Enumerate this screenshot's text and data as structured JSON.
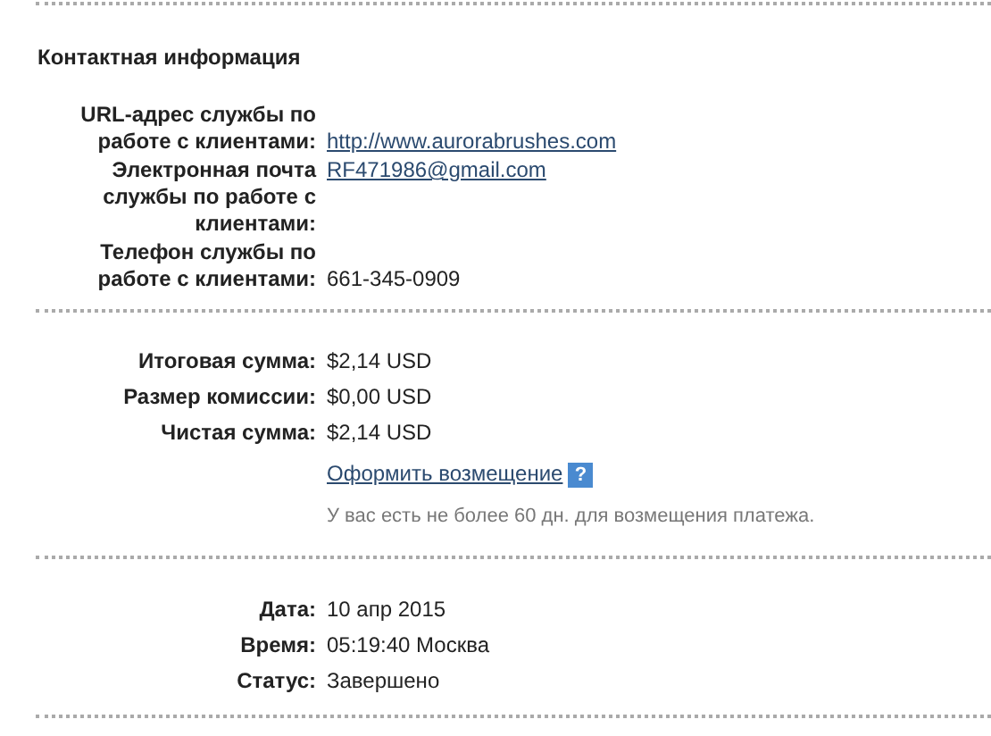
{
  "heading": "Контактная информация",
  "sections": [
    {
      "rows": [
        {
          "kind": "trailing",
          "label": "URL-адрес службы по работе с клиентами:",
          "value": {
            "kind": "link",
            "text": "http://www.aurorabrushes.com"
          }
        },
        {
          "kind": "pair",
          "label": "Электронная почта службы по работе с клиентами:",
          "value": {
            "kind": "link",
            "text": "RF471986@gmail.com"
          }
        },
        {
          "kind": "trailing",
          "label": "Телефон службы по работе с клиентами:",
          "value": {
            "kind": "plain",
            "text": "661-345-0909"
          }
        }
      ]
    },
    {
      "rows": [
        {
          "kind": "pair",
          "label": "Итоговая сумма:",
          "value": {
            "kind": "plain",
            "text": "$2,14 USD"
          }
        },
        {
          "kind": "pair",
          "label": "Размер комиссии:",
          "value": {
            "kind": "plain",
            "text": "$0,00 USD"
          }
        },
        {
          "kind": "pair",
          "label": "Чистая сумма:",
          "value": {
            "kind": "plain",
            "text": "$2,14 USD"
          }
        },
        {
          "kind": "action",
          "value": "Оформить возмещение",
          "help": "?"
        },
        {
          "kind": "note",
          "value": "У вас есть не более 60 дн. для возмещения платежа."
        }
      ]
    },
    {
      "rows": [
        {
          "kind": "pair",
          "label": "Дата:",
          "value": {
            "kind": "plain",
            "text": "10 апр 2015"
          }
        },
        {
          "kind": "pair",
          "label": "Время:",
          "value": {
            "kind": "plain",
            "text": "05:19:40 Москва"
          }
        },
        {
          "kind": "pair",
          "label": "Статус:",
          "value": {
            "kind": "plain",
            "text": "Завершено"
          }
        }
      ]
    }
  ]
}
